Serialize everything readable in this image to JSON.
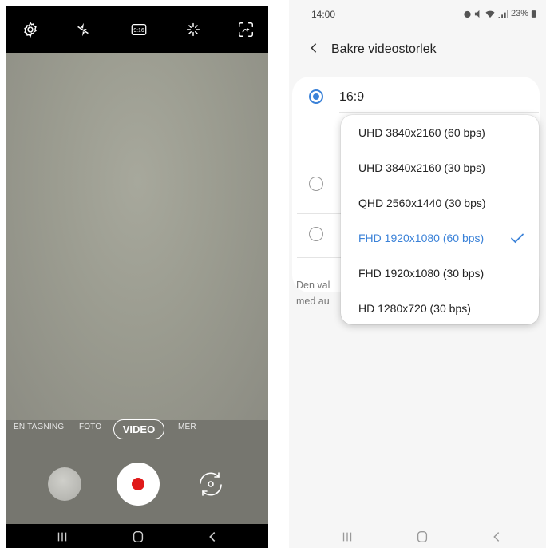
{
  "camera": {
    "top_icons": [
      "gear-icon",
      "flash-off-icon",
      "aspect-ratio-icon",
      "effects-icon",
      "scene-optimizer-icon"
    ],
    "aspect_ratio_label": "9:16",
    "modes": {
      "single_take": "EN TAGNING",
      "photo": "FOTO",
      "video": "VIDEO",
      "more": "MER"
    },
    "active_mode": "VIDEO",
    "record_color": "#e01a1a"
  },
  "settings": {
    "status": {
      "time": "14:00",
      "battery": "23%"
    },
    "title": "Bakre videostorlek",
    "selected_ratio": "16:9",
    "description_fragment": [
      "Den val",
      "med au"
    ],
    "dropdown_options": [
      "UHD 3840x2160 (60 bps)",
      "UHD 3840x2160 (30 bps)",
      "QHD 2560x1440 (30 bps)",
      "FHD 1920x1080 (60 bps)",
      "FHD 1920x1080 (30 bps)",
      "HD 1280x720 (30 bps)"
    ],
    "selected_option_index": 3,
    "accent_color": "#3b82d8"
  },
  "nav_icons": [
    "recent-apps-icon",
    "home-icon",
    "back-icon"
  ]
}
